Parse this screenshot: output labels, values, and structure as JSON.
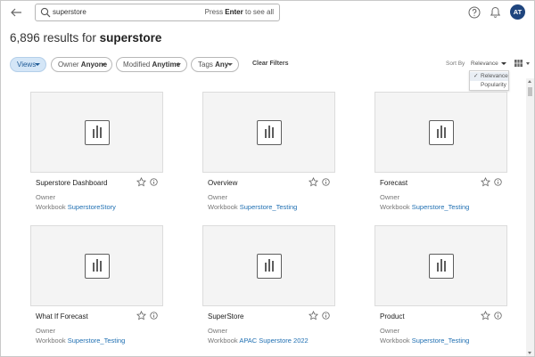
{
  "search": {
    "query": "superstore",
    "hint_prefix": "Press ",
    "hint_key": "Enter",
    "hint_suffix": " to see all"
  },
  "header": {
    "avatar_initials": "AT"
  },
  "results": {
    "count": "6,896",
    "middle": " results for ",
    "term": "superstore"
  },
  "filters": {
    "views_label": "Views",
    "owner_label": "Owner",
    "owner_value": "Anyone",
    "modified_label": "Modified",
    "modified_value": "Anytime",
    "tags_label": "Tags",
    "tags_value": "Any",
    "clear_label": "Clear Filters"
  },
  "sort": {
    "label": "Sort By",
    "value": "Relevance",
    "options": [
      "Relevance",
      "Popularity"
    ]
  },
  "cards": [
    {
      "title": "Superstore Dashboard",
      "owner_label": "Owner",
      "workbook_label": "Workbook",
      "workbook": "SuperstoreStory"
    },
    {
      "title": "Overview",
      "owner_label": "Owner",
      "workbook_label": "Workbook",
      "workbook": "Superstore_Testing"
    },
    {
      "title": "Forecast",
      "owner_label": "Owner",
      "workbook_label": "Workbook",
      "workbook": "Superstore_Testing"
    },
    {
      "title": "What If Forecast",
      "owner_label": "Owner",
      "workbook_label": "Workbook",
      "workbook": "Superstore_Testing"
    },
    {
      "title": "SuperStore",
      "owner_label": "Owner",
      "workbook_label": "Workbook",
      "workbook": "APAC Superstore 2022"
    },
    {
      "title": "Product",
      "owner_label": "Owner",
      "workbook_label": "Workbook",
      "workbook": "Superstore_Testing"
    }
  ],
  "icons": {
    "back": "back-arrow-icon",
    "search": "search-icon",
    "help": "help-icon",
    "bell": "bell-icon",
    "view": "view-icon",
    "star": "star-icon",
    "info": "info-icon",
    "grid": "grid-view-icon"
  },
  "colors": {
    "accent": "#1f6fb2",
    "avatar_bg": "#1f457e",
    "views_chip_bg": "#d4e6f7"
  }
}
